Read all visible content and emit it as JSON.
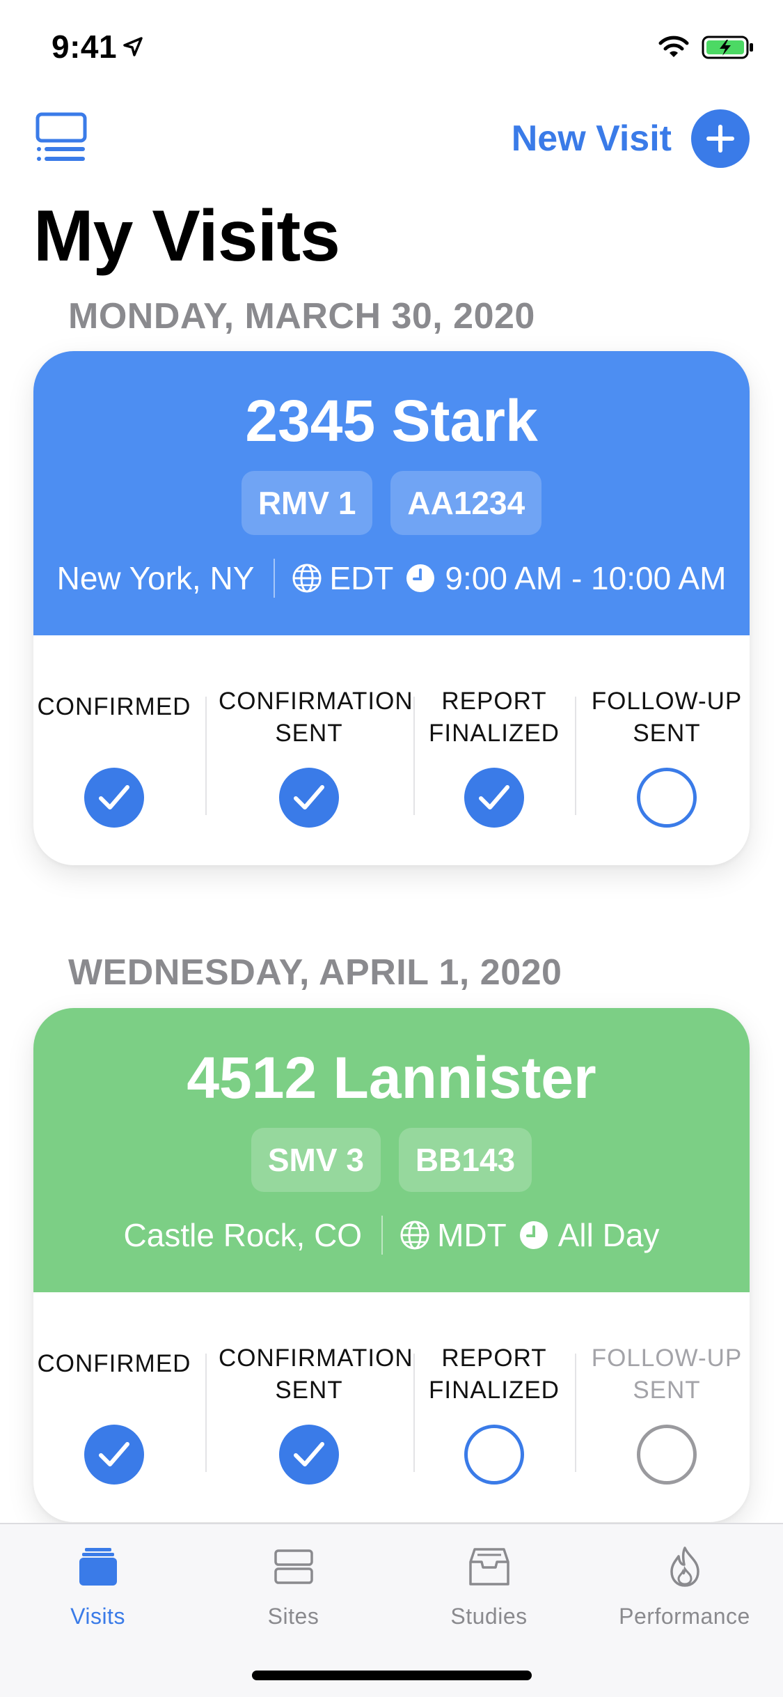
{
  "status_bar": {
    "time": "9:41"
  },
  "nav": {
    "new_visit_label": "New Visit"
  },
  "page_title": "My Visits",
  "visits": [
    {
      "date": "MONDAY, MARCH 30, 2020",
      "title": "2345 Stark",
      "color": "#4d8ef2",
      "chips": [
        "RMV 1",
        "AA1234"
      ],
      "city": "New York, NY",
      "timezone": "EDT",
      "time": "9:00 AM - 10:00 AM",
      "steps": [
        {
          "label_lines": [
            "CONFIRMED"
          ],
          "state": "checked"
        },
        {
          "label_lines": [
            "CONFIRMATION",
            "SENT"
          ],
          "state": "checked"
        },
        {
          "label_lines": [
            "REPORT",
            "FINALIZED"
          ],
          "state": "checked"
        },
        {
          "label_lines": [
            "FOLLOW-UP",
            "SENT"
          ],
          "state": "open"
        }
      ]
    },
    {
      "date": "WEDNESDAY, APRIL 1, 2020",
      "title": "4512 Lannister",
      "color": "#7ccf85",
      "chips": [
        "SMV 3",
        "BB143"
      ],
      "city": "Castle Rock, CO",
      "timezone": "MDT",
      "time": "All Day",
      "steps": [
        {
          "label_lines": [
            "CONFIRMED"
          ],
          "state": "checked"
        },
        {
          "label_lines": [
            "CONFIRMATION",
            "SENT"
          ],
          "state": "checked"
        },
        {
          "label_lines": [
            "REPORT",
            "FINALIZED"
          ],
          "state": "open"
        },
        {
          "label_lines": [
            "FOLLOW-UP",
            "SENT"
          ],
          "state": "muted"
        }
      ]
    }
  ],
  "tabs": [
    {
      "label": "Visits",
      "icon": "visits-icon",
      "active": true
    },
    {
      "label": "Sites",
      "icon": "sites-icon",
      "active": false
    },
    {
      "label": "Studies",
      "icon": "studies-icon",
      "active": false
    },
    {
      "label": "Performance",
      "icon": "performance-icon",
      "active": false
    }
  ],
  "colors": {
    "accent": "#3a7be8",
    "inactive": "#8a8a8e"
  }
}
